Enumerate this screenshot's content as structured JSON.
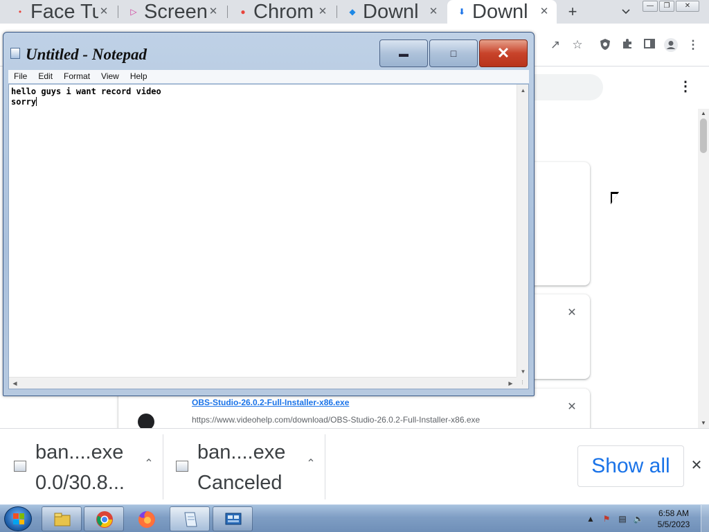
{
  "browser": {
    "tabs": [
      {
        "title": "Face Tu",
        "icon": "dot-favicon-icon",
        "active": false
      },
      {
        "title": "Screen",
        "icon": "screencast-favicon-icon",
        "active": false
      },
      {
        "title": "Chrom",
        "icon": "chrome-favicon-icon",
        "active": false
      },
      {
        "title": "Downl",
        "icon": "dropbox-favicon-icon",
        "active": false
      },
      {
        "title": "Downl",
        "icon": "download-arrow-icon",
        "active": true
      }
    ],
    "new_tab_label": "+",
    "downloads": [
      {
        "file": "OBS-Studio-26.0.2-Full-Installer-x86.exe",
        "url": "https://www.videohelp.com/download/OBS-Studio-26.0.2-Full-Installer-x86.exe"
      }
    ]
  },
  "notepad": {
    "title": "Untitled - Notepad",
    "menu": [
      "File",
      "Edit",
      "Format",
      "View",
      "Help"
    ],
    "lines": [
      "hello guys i want record video",
      "sorry"
    ]
  },
  "shelf": {
    "items": [
      {
        "name": "ban....exe",
        "status": "0.0/30.8..."
      },
      {
        "name": "ban....exe",
        "status": "Canceled"
      }
    ],
    "show_all": "Show all"
  },
  "taskbar": {
    "apps": [
      "explorer-icon",
      "chrome-icon",
      "firefox-icon",
      "notepad-icon",
      "control-panel-icon"
    ],
    "time": "6:58 AM",
    "date": "5/5/2023"
  },
  "colors": {
    "accent": "#1a73e8",
    "close_red": "#c8432a"
  }
}
